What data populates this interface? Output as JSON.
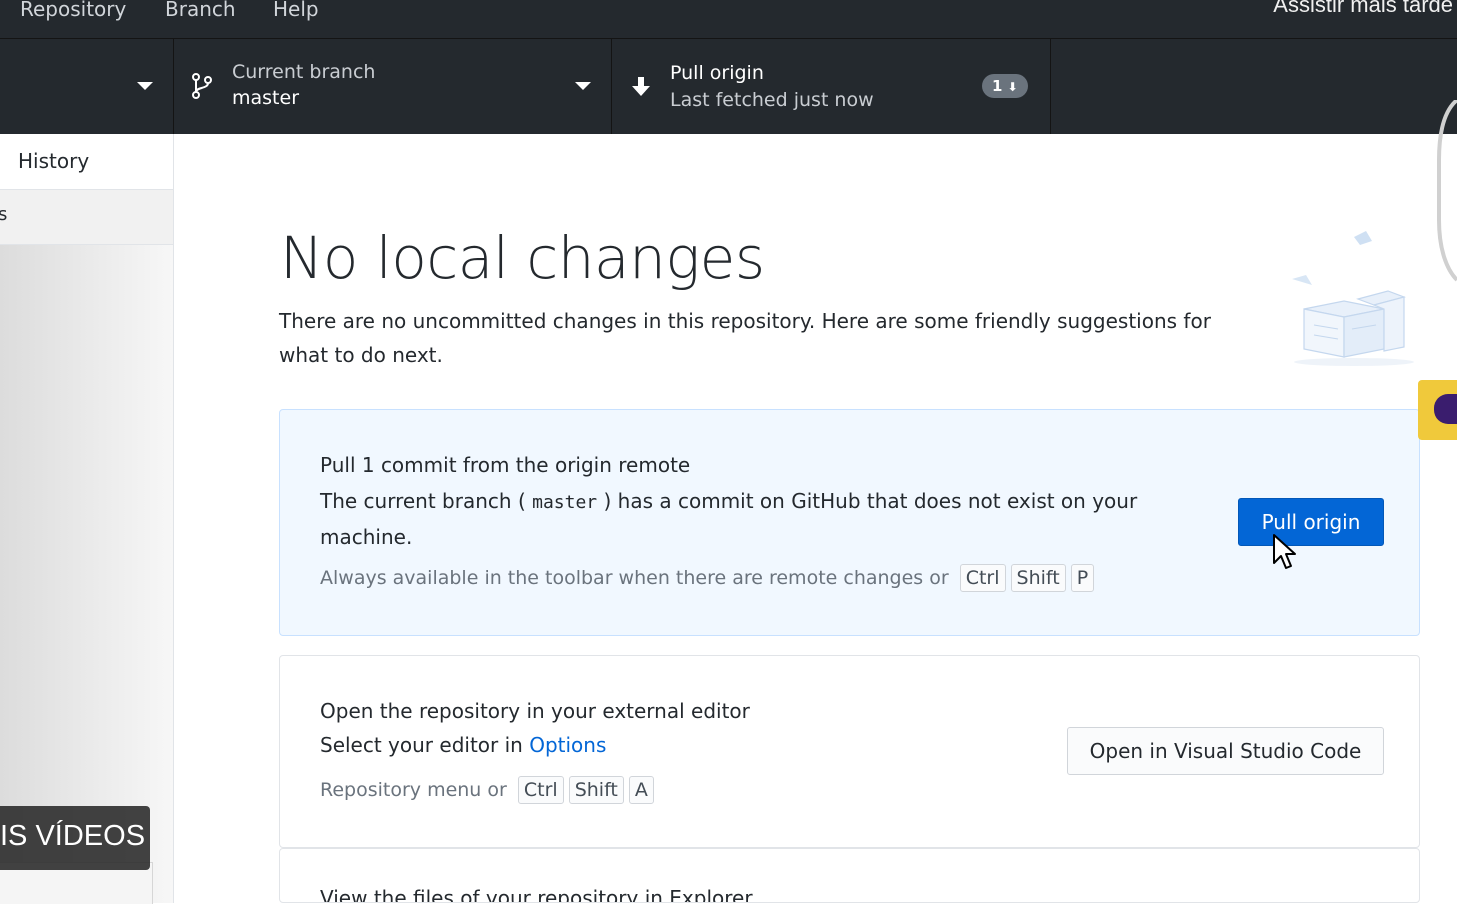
{
  "menu": {
    "items": [
      "Repository",
      "Branch",
      "Help"
    ],
    "overlay_watch_later": "Assistir mais tarde"
  },
  "toolbar": {
    "branch": {
      "title": "Current branch",
      "value": "master"
    },
    "fetch": {
      "title": "Pull origin",
      "subtitle": "Last fetched just now",
      "badge": "1"
    }
  },
  "sidebar": {
    "tabs": [
      {
        "label": "History"
      },
      {
        "label": "s"
      }
    ]
  },
  "overlay_more_videos": "IS VÍDEOS",
  "main": {
    "title": "No local changes",
    "description": "There are no uncommitted changes in this repository. Here are some friendly suggestions for what to do next.",
    "pull_card": {
      "title": "Pull 1 commit from the origin remote",
      "desc_before": "The current branch (",
      "branch": "master",
      "desc_after": ") has a commit on GitHub that does not exist on your machine.",
      "hint": "Always available in the toolbar when there are remote changes or",
      "keys": [
        "Ctrl",
        "Shift",
        "P"
      ],
      "button": "Pull origin"
    },
    "editor_card": {
      "title": "Open the repository in your external editor",
      "desc_before": "Select your editor in ",
      "link": "Options",
      "hint": "Repository menu or",
      "keys": [
        "Ctrl",
        "Shift",
        "A"
      ],
      "button": "Open in Visual Studio Code"
    },
    "explorer_card": {
      "title": "View the files of your repository in Explorer"
    }
  },
  "colors": {
    "toolbar_bg": "#24292e",
    "accent": "#0366d6",
    "pull_card_bg": "#f1f8ff"
  }
}
